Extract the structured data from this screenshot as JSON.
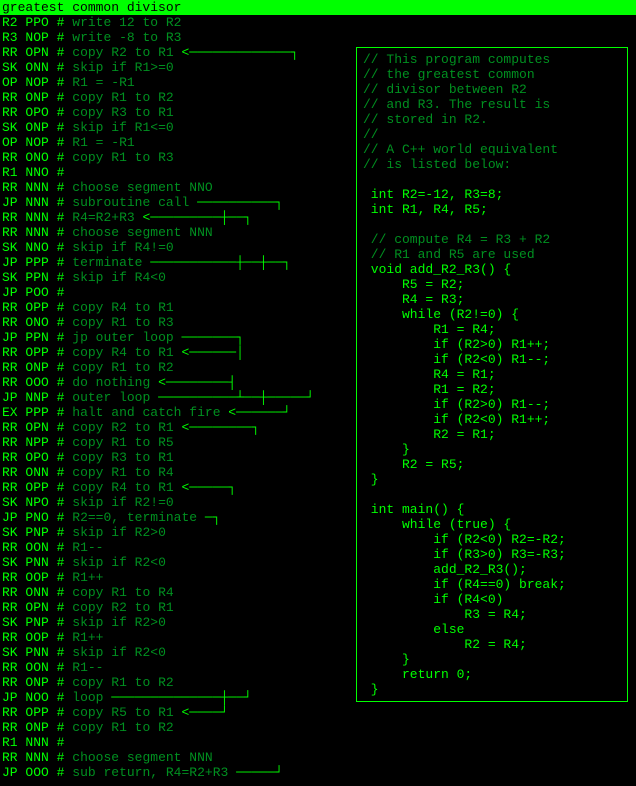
{
  "title": "greatest common divisor",
  "code": [
    {
      "op": "R2",
      "arg": "PPO",
      "cmt": "write 12 to R2",
      "tail": ""
    },
    {
      "op": "R3",
      "arg": "NOP",
      "cmt": "write -8 to R3",
      "tail": ""
    },
    {
      "op": "RR",
      "arg": "OPN",
      "cmt": "copy R2 to R1",
      "tail": "<─────────────┐"
    },
    {
      "op": "SK",
      "arg": "ONN",
      "cmt": "skip if R1>=0",
      "tail": ""
    },
    {
      "op": "OP",
      "arg": "NOP",
      "cmt": "R1 = -R1",
      "tail": ""
    },
    {
      "op": "RR",
      "arg": "ONP",
      "cmt": "copy R1 to R2",
      "tail": ""
    },
    {
      "op": "RR",
      "arg": "OPO",
      "cmt": "copy R3 to R1",
      "tail": ""
    },
    {
      "op": "SK",
      "arg": "ONP",
      "cmt": "skip if R1<=0",
      "tail": ""
    },
    {
      "op": "OP",
      "arg": "NOP",
      "cmt": "R1 = -R1",
      "tail": ""
    },
    {
      "op": "RR",
      "arg": "ONO",
      "cmt": "copy R1 to R3",
      "tail": ""
    },
    {
      "op": "R1",
      "arg": "NNO",
      "cmt": "",
      "tail": ""
    },
    {
      "op": "RR",
      "arg": "NNN",
      "cmt": "choose segment NNO",
      "tail": ""
    },
    {
      "op": "JP",
      "arg": "NNN",
      "cmt": "subroutine call",
      "tail": "──────────┐"
    },
    {
      "op": "RR",
      "arg": "NNN",
      "cmt": "R4=R2+R3",
      "tail": "<─────────┼──┐"
    },
    {
      "op": "RR",
      "arg": "NNN",
      "cmt": "choose segment NNN",
      "tail": ""
    },
    {
      "op": "SK",
      "arg": "NNO",
      "cmt": "skip if R4!=0",
      "tail": ""
    },
    {
      "op": "JP",
      "arg": "PPP",
      "cmt": "terminate",
      "tail": "───────────┼──┼──┐"
    },
    {
      "op": "SK",
      "arg": "PPN",
      "cmt": "skip if R4<0",
      "tail": ""
    },
    {
      "op": "JP",
      "arg": "POO",
      "cmt": "",
      "tail": ""
    },
    {
      "op": "RR",
      "arg": "OPP",
      "cmt": "copy R4 to R1",
      "tail": ""
    },
    {
      "op": "RR",
      "arg": "ONO",
      "cmt": "copy R1 to R3",
      "tail": ""
    },
    {
      "op": "JP",
      "arg": "PPN",
      "cmt": "jp outer loop",
      "tail": "───────┐"
    },
    {
      "op": "RR",
      "arg": "OPP",
      "cmt": "copy R4 to R1",
      "tail": "<──────│"
    },
    {
      "op": "RR",
      "arg": "ONP",
      "cmt": "copy R1 to R2",
      "tail": ""
    },
    {
      "op": "RR",
      "arg": "OOO",
      "cmt": "do nothing",
      "tail": "<────────┤"
    },
    {
      "op": "JP",
      "arg": "NNP",
      "cmt": "outer loop",
      "tail": "──────────┴──┼─────┘"
    },
    {
      "op": "EX",
      "arg": "PPP",
      "cmt": "halt and catch fire",
      "tail": "<──────┘"
    },
    {
      "op": "RR",
      "arg": "OPN",
      "cmt": "copy R2 to R1",
      "tail": "<────────┐"
    },
    {
      "op": "RR",
      "arg": "NPP",
      "cmt": "copy R1 to R5",
      "tail": ""
    },
    {
      "op": "RR",
      "arg": "OPO",
      "cmt": "copy R3 to R1",
      "tail": ""
    },
    {
      "op": "RR",
      "arg": "ONN",
      "cmt": "copy R1 to R4",
      "tail": ""
    },
    {
      "op": "RR",
      "arg": "OPP",
      "cmt": "copy R4 to R1",
      "tail": "<─────┐"
    },
    {
      "op": "SK",
      "arg": "NPO",
      "cmt": "skip if R2!=0",
      "tail": ""
    },
    {
      "op": "JP",
      "arg": "PNO",
      "cmt": "R2==0, terminate",
      "tail": "─┐"
    },
    {
      "op": "SK",
      "arg": "PNP",
      "cmt": "skip if R2>0",
      "tail": ""
    },
    {
      "op": "RR",
      "arg": "OON",
      "cmt": "R1--",
      "tail": ""
    },
    {
      "op": "SK",
      "arg": "PNN",
      "cmt": "skip if R2<0",
      "tail": ""
    },
    {
      "op": "RR",
      "arg": "OOP",
      "cmt": "R1++",
      "tail": ""
    },
    {
      "op": "RR",
      "arg": "ONN",
      "cmt": "copy R1 to R4",
      "tail": ""
    },
    {
      "op": "RR",
      "arg": "OPN",
      "cmt": "copy R2 to R1",
      "tail": ""
    },
    {
      "op": "SK",
      "arg": "PNP",
      "cmt": "skip if R2>0",
      "tail": ""
    },
    {
      "op": "RR",
      "arg": "OOP",
      "cmt": "R1++",
      "tail": ""
    },
    {
      "op": "SK",
      "arg": "PNN",
      "cmt": "skip if R2<0",
      "tail": ""
    },
    {
      "op": "RR",
      "arg": "OON",
      "cmt": "R1--",
      "tail": ""
    },
    {
      "op": "RR",
      "arg": "ONP",
      "cmt": "copy R1 to R2",
      "tail": ""
    },
    {
      "op": "JP",
      "arg": "NOO",
      "cmt": "loop",
      "tail": "──────────────┼──┘"
    },
    {
      "op": "RR",
      "arg": "OPP",
      "cmt": "copy R5 to R1",
      "tail": "<────┘"
    },
    {
      "op": "RR",
      "arg": "ONP",
      "cmt": "copy R1 to R2",
      "tail": ""
    },
    {
      "op": "R1",
      "arg": "NNN",
      "cmt": "",
      "tail": ""
    },
    {
      "op": "RR",
      "arg": "NNN",
      "cmt": "choose segment NNN",
      "tail": ""
    },
    {
      "op": "JP",
      "arg": "OOO",
      "cmt": "sub return, R4=R2+R3",
      "tail": "─────┘"
    }
  ],
  "side": [
    {
      "t": "// This program computes",
      "c": 1
    },
    {
      "t": "// the greatest common",
      "c": 1
    },
    {
      "t": "// divisor between R2",
      "c": 1
    },
    {
      "t": "// and R3. The result is",
      "c": 1
    },
    {
      "t": "// stored in R2.",
      "c": 1
    },
    {
      "t": "//",
      "c": 1
    },
    {
      "t": "// A C++ world equivalent",
      "c": 1
    },
    {
      "t": "// is listed below:",
      "c": 1
    },
    {
      "t": "",
      "c": 0
    },
    {
      "t": " int R2=-12, R3=8;",
      "c": 0
    },
    {
      "t": " int R1, R4, R5;",
      "c": 0
    },
    {
      "t": "",
      "c": 0
    },
    {
      "t": " // compute R4 = R3 + R2",
      "c": 1
    },
    {
      "t": " // R1 and R5 are used",
      "c": 1
    },
    {
      "t": " void add_R2_R3() {",
      "c": 0
    },
    {
      "t": "     R5 = R2;",
      "c": 0
    },
    {
      "t": "     R4 = R3;",
      "c": 0
    },
    {
      "t": "     while (R2!=0) {",
      "c": 0
    },
    {
      "t": "         R1 = R4;",
      "c": 0
    },
    {
      "t": "         if (R2>0) R1++;",
      "c": 0
    },
    {
      "t": "         if (R2<0) R1--;",
      "c": 0
    },
    {
      "t": "         R4 = R1;",
      "c": 0
    },
    {
      "t": "         R1 = R2;",
      "c": 0
    },
    {
      "t": "         if (R2>0) R1--;",
      "c": 0
    },
    {
      "t": "         if (R2<0) R1++;",
      "c": 0
    },
    {
      "t": "         R2 = R1;",
      "c": 0
    },
    {
      "t": "     }",
      "c": 0
    },
    {
      "t": "     R2 = R5;",
      "c": 0
    },
    {
      "t": " }",
      "c": 0
    },
    {
      "t": "",
      "c": 0
    },
    {
      "t": " int main() {",
      "c": 0
    },
    {
      "t": "     while (true) {",
      "c": 0
    },
    {
      "t": "         if (R2<0) R2=-R2;",
      "c": 0
    },
    {
      "t": "         if (R3>0) R3=-R3;",
      "c": 0
    },
    {
      "t": "         add_R2_R3();",
      "c": 0
    },
    {
      "t": "         if (R4==0) break;",
      "c": 0
    },
    {
      "t": "         if (R4<0)",
      "c": 0
    },
    {
      "t": "             R3 = R4;",
      "c": 0
    },
    {
      "t": "         else",
      "c": 0
    },
    {
      "t": "             R2 = R4;",
      "c": 0
    },
    {
      "t": "     }",
      "c": 0
    },
    {
      "t": "     return 0;",
      "c": 0
    },
    {
      "t": " }",
      "c": 0
    }
  ]
}
